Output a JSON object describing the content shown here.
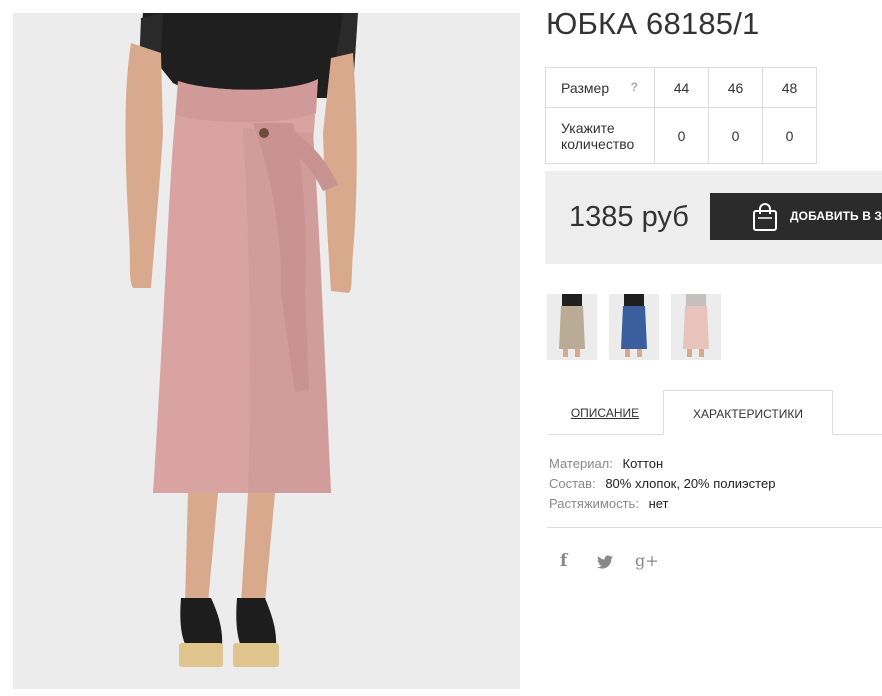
{
  "product": {
    "title": "ЮБКА 68185/1",
    "price": "1385 руб"
  },
  "sizes": {
    "size_label": "Размер",
    "help_mark": "?",
    "quantity_label": "Укажите количество",
    "values": [
      "44",
      "46",
      "48"
    ],
    "quantities": [
      "0",
      "0",
      "0"
    ]
  },
  "cart": {
    "button_label": "ДОБАВИТЬ В ЗАКАЗ",
    "icon": "shopping-bag-icon"
  },
  "thumbnails": [
    {
      "name": "beige-skirt",
      "color": "#b9ab96"
    },
    {
      "name": "blue-skirt",
      "color": "#3a5e9e"
    },
    {
      "name": "pink-skirt",
      "color": "#e8c4bd"
    }
  ],
  "tabs": {
    "description": "ОПИСАНИЕ",
    "characteristics": "ХАРАКТЕРИСТИКИ",
    "active": "characteristics"
  },
  "specs": [
    {
      "key": "Материал:",
      "value": "Коттон"
    },
    {
      "key": "Состав:",
      "value": "80% хлопок, 20% полиэстер"
    },
    {
      "key": "Растяжимость:",
      "value": "нет"
    }
  ],
  "social": {
    "facebook": "f",
    "twitter": "twitter-bird",
    "google_plus": "g+"
  },
  "colors": {
    "skirt": "#d8a3a0",
    "button_bg": "#2b2b2b",
    "buy_box_bg": "#eeeeee",
    "border": "#dcdcdc"
  }
}
